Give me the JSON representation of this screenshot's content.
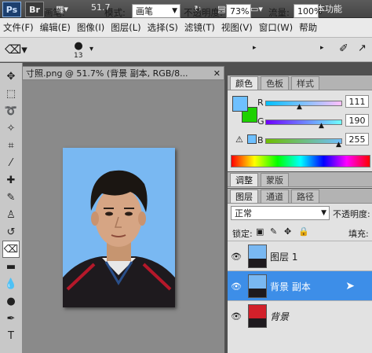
{
  "appbar": {
    "ps_logo": "Ps",
    "br_logo": "Br",
    "zoom": "51.7",
    "workspace": "基本功能"
  },
  "menu": [
    "文件(F)",
    "编辑(E)",
    "图像(I)",
    "图层(L)",
    "选择(S)",
    "滤镜(T)",
    "视图(V)",
    "窗口(W)",
    "帮助"
  ],
  "options": {
    "brush_label": "画笔:",
    "brush_size": "13",
    "mode_label": "模式:",
    "mode_value": "画笔",
    "opacity_label": "不透明度:",
    "opacity_value": "73%",
    "flow_label": "流量:",
    "flow_value": "100%"
  },
  "document": {
    "tab_title": "寸照.png @ 51.7% (背景 副本, RGB/8..."
  },
  "color_panel": {
    "tabs": [
      "颜色",
      "色板",
      "样式"
    ],
    "r_label": "R",
    "r_value": "111",
    "g_label": "G",
    "g_value": "190",
    "b_label": "B",
    "b_value": "255",
    "foreground": "#6ec0ff",
    "background": "#1dd100"
  },
  "adjust_tabs": [
    "调整",
    "蒙版"
  ],
  "layers_panel": {
    "tabs": [
      "图层",
      "通道",
      "路径"
    ],
    "blend_mode": "正常",
    "opacity_label": "不透明度:",
    "lock_label": "锁定:",
    "fill_label": "填充:",
    "layers": [
      {
        "name": "图层 1",
        "selected": false
      },
      {
        "name": "背景 副本",
        "selected": true
      },
      {
        "name": "背景",
        "selected": false
      }
    ]
  }
}
